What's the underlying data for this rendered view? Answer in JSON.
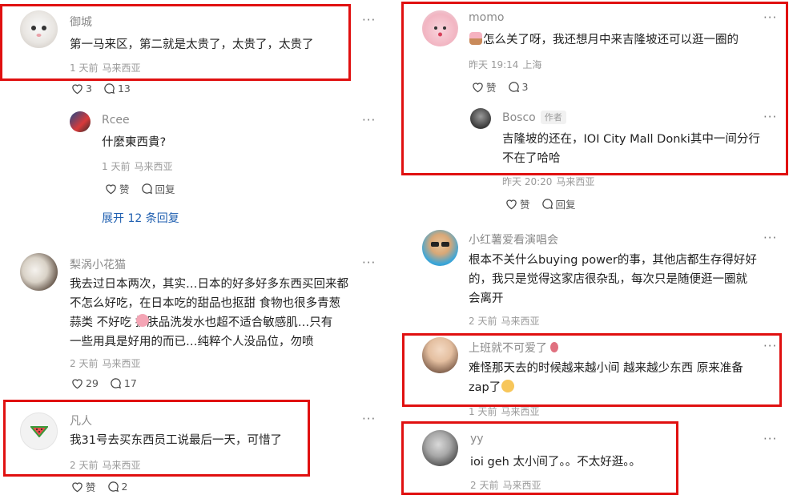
{
  "colors": {
    "highlight": "#e01010",
    "link": "#1f5fb0",
    "meta": "#9a9a9a",
    "text": "#222222"
  },
  "icons": {
    "like": "heart-icon",
    "reply": "comment-bubble-icon",
    "more": "more-dots-icon"
  },
  "comments": [
    {
      "user": "御城",
      "text": [
        "第一马来区，第二就是太贵了，太贵了，太贵了"
      ],
      "time": "1 天前",
      "loc": "马来西亚",
      "likes": "3",
      "replies": "13"
    },
    {
      "user": "Rcee",
      "text": [
        "什麼東西貴?"
      ],
      "time": "1 天前",
      "loc": "马来西亚",
      "likes": "赞",
      "replies": "回复",
      "expand": "展开 12 条回复"
    },
    {
      "user": "梨涡小花猫",
      "text": [
        "我去过日本两次，其实…日本的好多好多东西买回来都",
        "不怎么好吃，在日本吃的甜品也抠甜 食物也很多青葱",
        "蒜类 不好吃 护肤品洗发水也超不适合敏感肌…只有",
        "一些用具是好用的而已…纯粹个人没品位，勿喷"
      ],
      "time": "2 天前",
      "loc": "马来西亚",
      "likes": "29",
      "replies": "17"
    },
    {
      "user": "凡人",
      "text": [
        "我31号去买东西员工说最后一天，可惜了"
      ],
      "time": "2 天前",
      "loc": "马来西亚",
      "likes": "赞",
      "replies": "2"
    },
    {
      "user": "momo",
      "text": [
        "怎么关了呀，我还想月中来吉隆坡还可以逛一圈的"
      ],
      "time": "昨天 19:14",
      "loc": "上海",
      "likes": "赞",
      "replies": "3"
    },
    {
      "user": "Bosco",
      "badge": "作者",
      "text": [
        "吉隆坡的还在，IOI City Mall Donki其中一间分行",
        "不在了哈哈"
      ],
      "time": "昨天 20:20",
      "loc": "马来西亚",
      "likes": "赞",
      "replies": "回复"
    },
    {
      "user": "小红薯爱看演唱会",
      "text": [
        "根本不关什么buying power的事，其他店都生存得好好",
        "的，我只是觉得这家店很杂乱，每次只是随便逛一圈就",
        "会离开"
      ],
      "time": "2 天前",
      "loc": "马来西亚"
    },
    {
      "user": "上班就不可爱了",
      "text": [
        "难怪那天去的时候越来越小间 越来越少东西 原来准备",
        "zap了"
      ],
      "time": "1 天前",
      "loc": "马来西亚"
    },
    {
      "user": "yy",
      "text": [
        "ioi geh 太小间了。。不太好逛。。"
      ],
      "time": "2 天前",
      "loc": "马来西亚"
    }
  ]
}
